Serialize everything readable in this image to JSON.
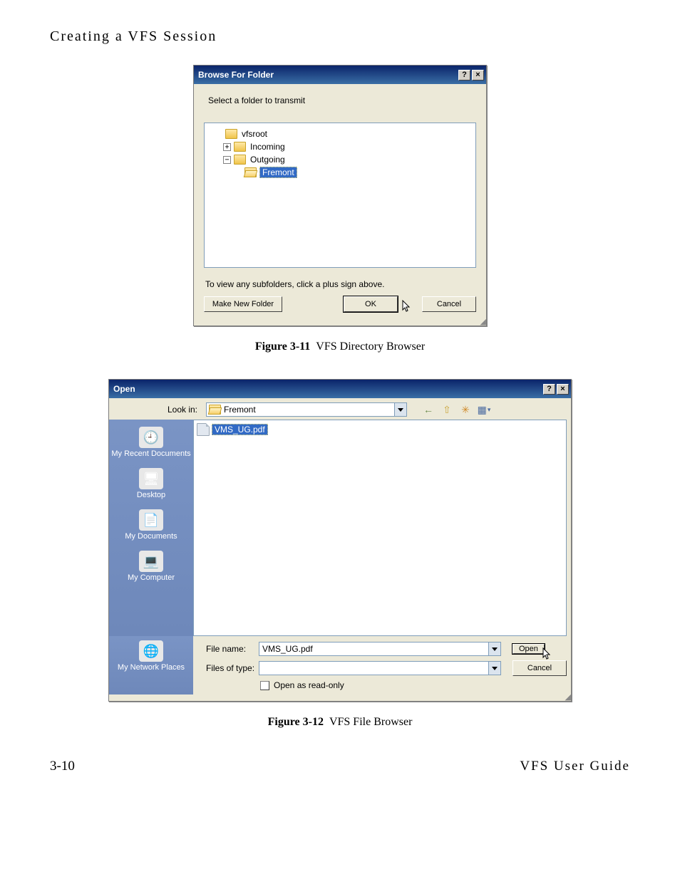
{
  "page": {
    "header": "Creating a VFS Session",
    "footer_left": "3-10",
    "footer_right": "VFS User Guide"
  },
  "figure1": {
    "caption_label": "Figure 3-11",
    "caption_text": "VFS Directory Browser"
  },
  "figure2": {
    "caption_label": "Figure 3-12",
    "caption_text": "VFS File Browser"
  },
  "browse_dialog": {
    "title": "Browse For Folder",
    "help_glyph": "?",
    "close_glyph": "×",
    "instruction": "Select a folder to transmit",
    "tree": {
      "root": "vfsroot",
      "incoming": "Incoming",
      "outgoing": "Outgoing",
      "fremont": "Fremont",
      "expand_plus": "+",
      "expand_minus": "−"
    },
    "hint": "To view any subfolders, click a plus sign above.",
    "make_new_folder": "Make New Folder",
    "ok": "OK",
    "cancel": "Cancel"
  },
  "open_dialog": {
    "title": "Open",
    "help_glyph": "?",
    "close_glyph": "×",
    "look_in_label": "Look in:",
    "look_in_value": "Fremont",
    "places": {
      "recent": "My Recent Documents",
      "desktop": "Desktop",
      "my_documents": "My Documents",
      "my_computer": "My Computer",
      "my_network": "My Network Places"
    },
    "file_list": {
      "item1": "VMS_UG.pdf"
    },
    "file_name_label": "File name:",
    "file_name_value": "VMS_UG.pdf",
    "files_of_type_label": "Files of type:",
    "files_of_type_value": "",
    "open_as_readonly": "Open as read-only",
    "open_btn": "Open",
    "cancel_btn": "Cancel",
    "tool_icons": {
      "back": "←",
      "up": "⇧",
      "new_folder": "✳",
      "views": "▦",
      "views_drop": "▾"
    }
  }
}
